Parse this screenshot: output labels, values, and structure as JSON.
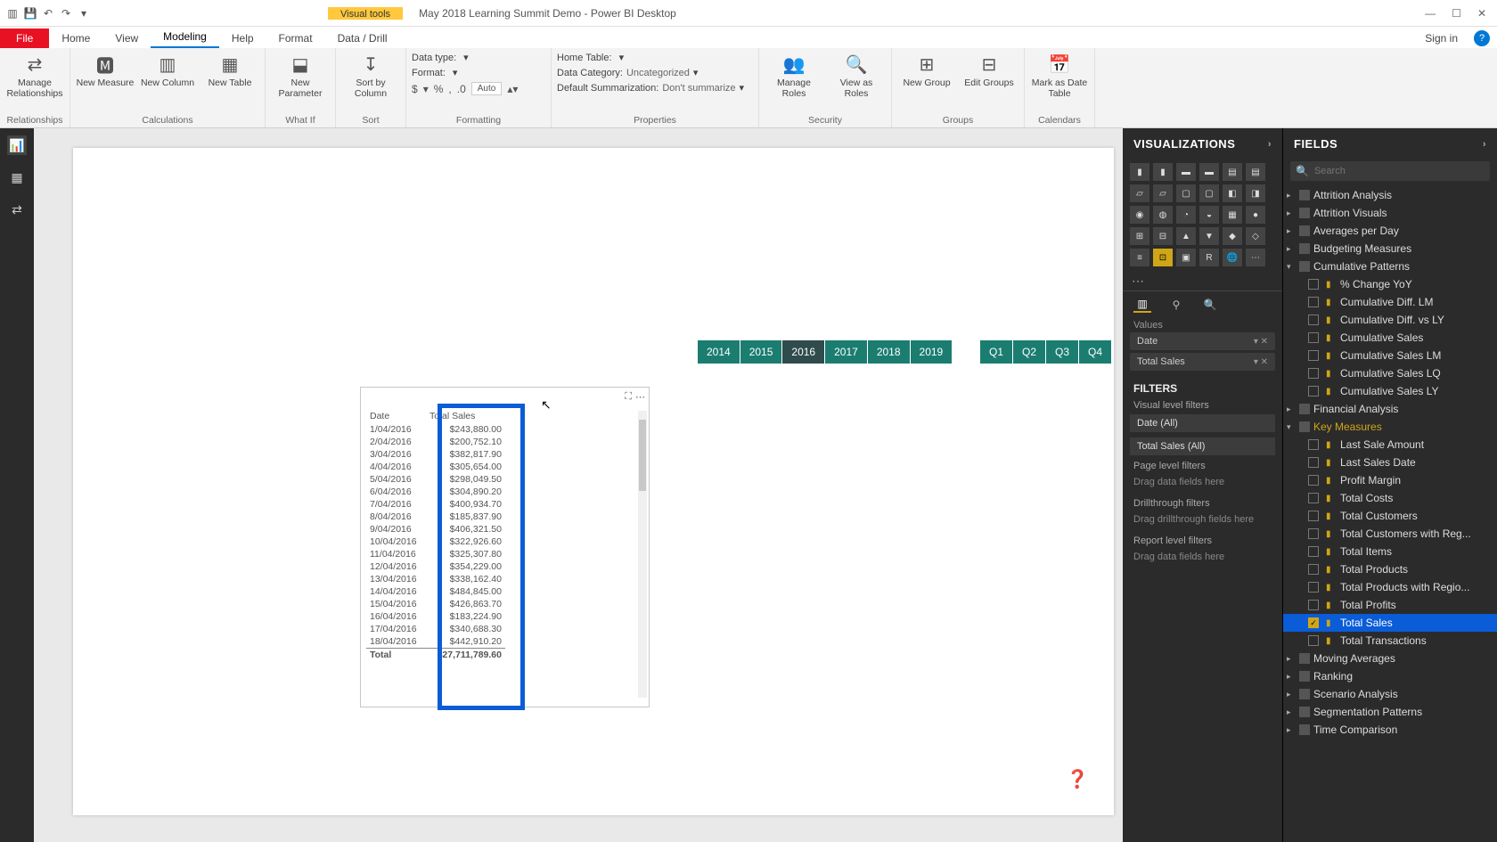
{
  "titlebar": {
    "doc_title": "May 2018 Learning Summit Demo - Power BI Desktop",
    "context_tab": "Visual tools"
  },
  "tabs": {
    "file": "File",
    "items": [
      "Home",
      "View",
      "Modeling",
      "Help",
      "Format",
      "Data / Drill"
    ],
    "active": "Modeling",
    "signin": "Sign in"
  },
  "ribbon": {
    "relationships": {
      "manage": "Manage\nRelationships",
      "group": "Relationships"
    },
    "calculations": {
      "new_measure": "New\nMeasure",
      "new_column": "New\nColumn",
      "new_table": "New\nTable",
      "group": "Calculations"
    },
    "whatif": {
      "new_param": "New\nParameter",
      "group": "What If"
    },
    "sort": {
      "sort_by": "Sort by\nColumn",
      "group": "Sort"
    },
    "formatting": {
      "data_type_lbl": "Data type:",
      "data_type_val": "",
      "format_lbl": "Format:",
      "format_val": "",
      "auto": "Auto",
      "group": "Formatting"
    },
    "properties": {
      "home_table_lbl": "Home Table:",
      "home_table_val": "",
      "data_cat_lbl": "Data Category:",
      "data_cat_val": "Uncategorized",
      "summarization_lbl": "Default Summarization:",
      "summarization_val": "Don't summarize",
      "group": "Properties"
    },
    "security": {
      "manage_roles": "Manage\nRoles",
      "view_as": "View as\nRoles",
      "group": "Security"
    },
    "groups_grp": {
      "new_group": "New\nGroup",
      "edit_groups": "Edit\nGroups",
      "group": "Groups"
    },
    "calendars": {
      "mark_date": "Mark as\nDate Table",
      "group": "Calendars"
    }
  },
  "slicers": {
    "years": [
      "2014",
      "2015",
      "2016",
      "2017",
      "2018",
      "2019"
    ],
    "year_selected": "2016",
    "quarters": [
      "Q1",
      "Q2",
      "Q3",
      "Q4"
    ]
  },
  "table_visual": {
    "columns": [
      "Date",
      "Total Sales"
    ],
    "rows": [
      [
        "1/04/2016",
        "$243,880.00"
      ],
      [
        "2/04/2016",
        "$200,752.10"
      ],
      [
        "3/04/2016",
        "$382,817.90"
      ],
      [
        "4/04/2016",
        "$305,654.00"
      ],
      [
        "5/04/2016",
        "$298,049.50"
      ],
      [
        "6/04/2016",
        "$304,890.20"
      ],
      [
        "7/04/2016",
        "$400,934.70"
      ],
      [
        "8/04/2016",
        "$185,837.90"
      ],
      [
        "9/04/2016",
        "$406,321.50"
      ],
      [
        "10/04/2016",
        "$322,926.60"
      ],
      [
        "11/04/2016",
        "$325,307.80"
      ],
      [
        "12/04/2016",
        "$354,229.00"
      ],
      [
        "13/04/2016",
        "$338,162.40"
      ],
      [
        "14/04/2016",
        "$484,845.00"
      ],
      [
        "15/04/2016",
        "$426,863.70"
      ],
      [
        "16/04/2016",
        "$183,224.90"
      ],
      [
        "17/04/2016",
        "$340,688.30"
      ],
      [
        "18/04/2016",
        "$442,910.20"
      ]
    ],
    "total_row": [
      "Total",
      "$27,711,789.60"
    ]
  },
  "viz_panel": {
    "title": "VISUALIZATIONS",
    "values_lbl": "Values",
    "wells": [
      "Date",
      "Total Sales"
    ],
    "filters_title": "FILTERS",
    "visual_filters_lbl": "Visual level filters",
    "visual_filters": [
      "Date (All)",
      "Total Sales (All)"
    ],
    "page_filters_lbl": "Page level filters",
    "drill_lbl": "Drillthrough filters",
    "drill_hint": "Drag drillthrough fields here",
    "report_filters_lbl": "Report level filters",
    "drop_hint": "Drag data fields here"
  },
  "fields_panel": {
    "title": "FIELDS",
    "search_placeholder": "Search",
    "tables": [
      {
        "name": "Attrition Analysis",
        "expanded": false
      },
      {
        "name": "Attrition Visuals",
        "expanded": false
      },
      {
        "name": "Averages per Day",
        "expanded": false
      },
      {
        "name": "Budgeting Measures",
        "expanded": false
      },
      {
        "name": "Cumulative Patterns",
        "expanded": true,
        "children": [
          "% Change YoY",
          "Cumulative Diff. LM",
          "Cumulative Diff. vs LY",
          "Cumulative Sales",
          "Cumulative Sales LM",
          "Cumulative Sales LQ",
          "Cumulative Sales LY"
        ]
      },
      {
        "name": "Financial Analysis",
        "expanded": false
      },
      {
        "name": "Key Measures",
        "expanded": true,
        "key": true,
        "children": [
          "Last Sale Amount",
          "Last Sales Date",
          "Profit Margin",
          "Total Costs",
          "Total Customers",
          "Total Customers with Reg...",
          "Total Items",
          "Total Products",
          "Total Products with Regio...",
          "Total Profits",
          "Total Sales",
          "Total Transactions"
        ]
      },
      {
        "name": "Moving Averages",
        "expanded": false
      },
      {
        "name": "Ranking",
        "expanded": false
      },
      {
        "name": "Scenario Analysis",
        "expanded": false
      },
      {
        "name": "Segmentation Patterns",
        "expanded": false
      },
      {
        "name": "Time Comparison",
        "expanded": false
      }
    ],
    "checked_field": "Total Sales",
    "highlighted_field": "Total Sales"
  }
}
